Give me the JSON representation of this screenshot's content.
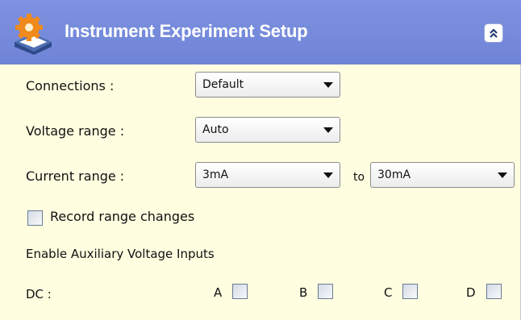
{
  "header": {
    "title": "Instrument Experiment Setup",
    "icon": "gear-settings-icon",
    "collapse_icon": "double-chevron-up-icon",
    "color": "#7488da"
  },
  "panel_background": "#fffee0",
  "connections": {
    "label": "Connections :",
    "value": "Default"
  },
  "voltage_range": {
    "label": "Voltage range :",
    "value": "Auto"
  },
  "current_range": {
    "label": "Current range :",
    "from_value": "3mA",
    "separator": "to",
    "to_value": "30mA"
  },
  "record_range_changes": {
    "label": "Record range changes",
    "checked": false
  },
  "aux_inputs": {
    "heading": "Enable Auxiliary Voltage Inputs",
    "dc_label": "DC :",
    "channels": [
      {
        "label": "A",
        "checked": false
      },
      {
        "label": "B",
        "checked": false
      },
      {
        "label": "C",
        "checked": false
      },
      {
        "label": "D",
        "checked": false
      }
    ]
  }
}
